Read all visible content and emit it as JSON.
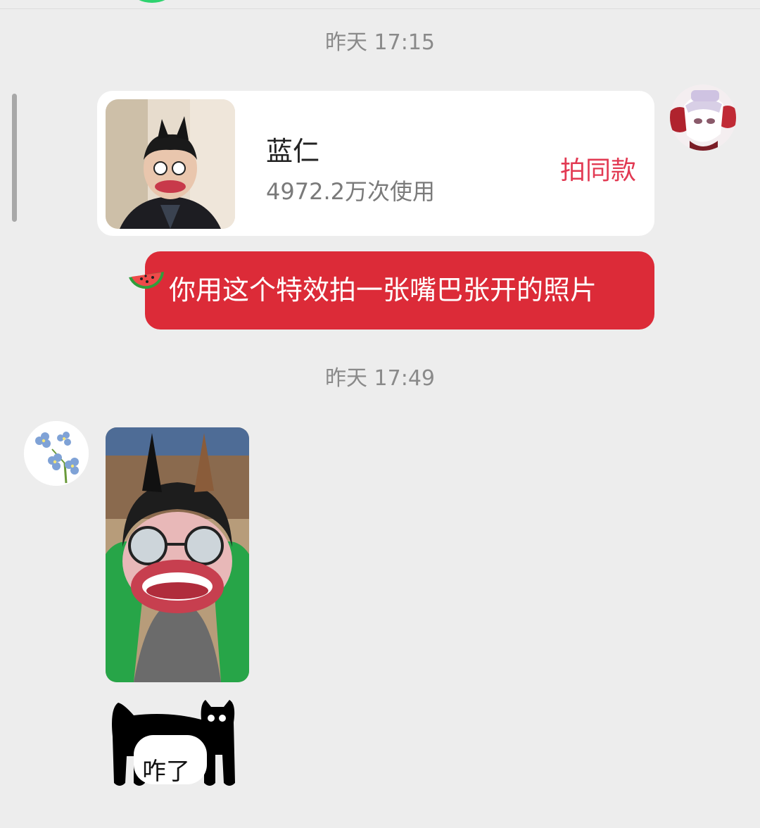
{
  "chat": {
    "timestamp_1": "昨天 17:15",
    "timestamp_2": "昨天 17:49",
    "effect_card": {
      "title": "蓝仁",
      "usage": "4972.2万次使用",
      "action": "拍同款"
    },
    "message_text": "你用这个特效拍一张嘴巴张开的照片",
    "sticker_text": "咋了"
  },
  "colors": {
    "background": "#ededed",
    "bubble_red": "#dc2b38",
    "action_pink": "#e23a53"
  }
}
